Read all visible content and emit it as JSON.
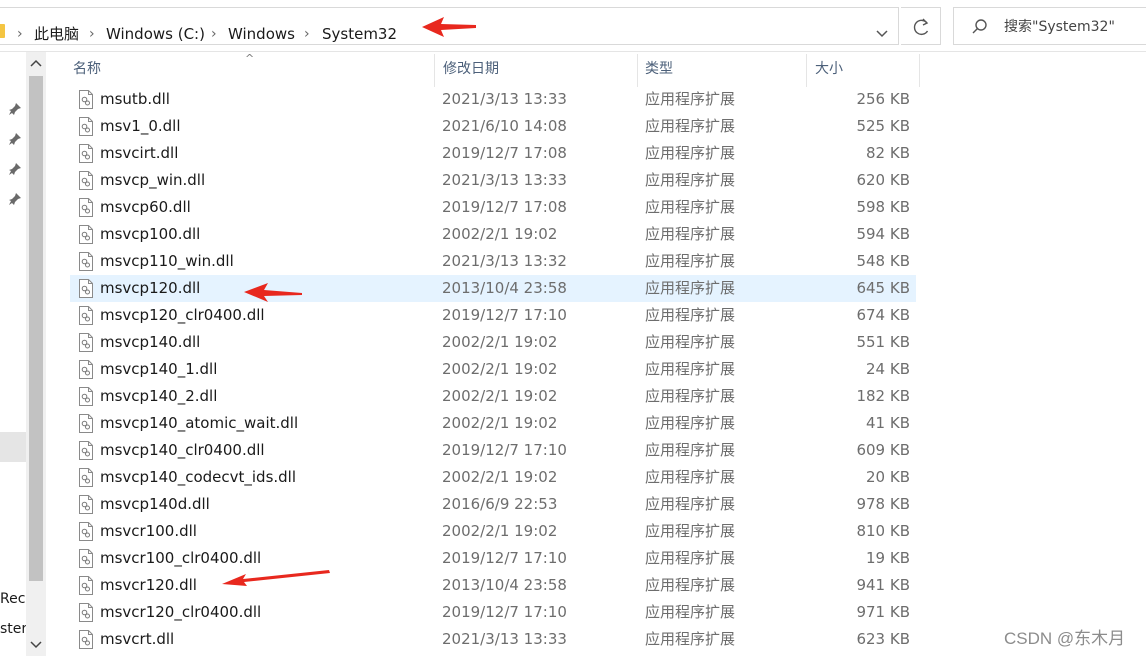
{
  "breadcrumb": {
    "items": [
      "此电脑",
      "Windows (C:)",
      "Windows",
      "System32"
    ]
  },
  "search": {
    "placeholder": "搜索\"System32\""
  },
  "nav": {
    "partial_labels": [
      "Reco",
      "ster"
    ]
  },
  "columns": {
    "name": "名称",
    "date": "修改日期",
    "type": "类型",
    "size": "大小"
  },
  "files": [
    {
      "name": "msutb.dll",
      "date": "2021/3/13 13:33",
      "type": "应用程序扩展",
      "size": "256 KB"
    },
    {
      "name": "msv1_0.dll",
      "date": "2021/6/10 14:08",
      "type": "应用程序扩展",
      "size": "525 KB"
    },
    {
      "name": "msvcirt.dll",
      "date": "2019/12/7 17:08",
      "type": "应用程序扩展",
      "size": "82 KB"
    },
    {
      "name": "msvcp_win.dll",
      "date": "2021/3/13 13:33",
      "type": "应用程序扩展",
      "size": "620 KB"
    },
    {
      "name": "msvcp60.dll",
      "date": "2019/12/7 17:08",
      "type": "应用程序扩展",
      "size": "598 KB"
    },
    {
      "name": "msvcp100.dll",
      "date": "2002/2/1 19:02",
      "type": "应用程序扩展",
      "size": "594 KB"
    },
    {
      "name": "msvcp110_win.dll",
      "date": "2021/3/13 13:32",
      "type": "应用程序扩展",
      "size": "548 KB"
    },
    {
      "name": "msvcp120.dll",
      "date": "2013/10/4 23:58",
      "type": "应用程序扩展",
      "size": "645 KB"
    },
    {
      "name": "msvcp120_clr0400.dll",
      "date": "2019/12/7 17:10",
      "type": "应用程序扩展",
      "size": "674 KB"
    },
    {
      "name": "msvcp140.dll",
      "date": "2002/2/1 19:02",
      "type": "应用程序扩展",
      "size": "551 KB"
    },
    {
      "name": "msvcp140_1.dll",
      "date": "2002/2/1 19:02",
      "type": "应用程序扩展",
      "size": "24 KB"
    },
    {
      "name": "msvcp140_2.dll",
      "date": "2002/2/1 19:02",
      "type": "应用程序扩展",
      "size": "182 KB"
    },
    {
      "name": "msvcp140_atomic_wait.dll",
      "date": "2002/2/1 19:02",
      "type": "应用程序扩展",
      "size": "41 KB"
    },
    {
      "name": "msvcp140_clr0400.dll",
      "date": "2019/12/7 17:10",
      "type": "应用程序扩展",
      "size": "609 KB"
    },
    {
      "name": "msvcp140_codecvt_ids.dll",
      "date": "2002/2/1 19:02",
      "type": "应用程序扩展",
      "size": "20 KB"
    },
    {
      "name": "msvcp140d.dll",
      "date": "2016/6/9 22:53",
      "type": "应用程序扩展",
      "size": "978 KB"
    },
    {
      "name": "msvcr100.dll",
      "date": "2002/2/1 19:02",
      "type": "应用程序扩展",
      "size": "810 KB"
    },
    {
      "name": "msvcr100_clr0400.dll",
      "date": "2019/12/7 17:10",
      "type": "应用程序扩展",
      "size": "19 KB"
    },
    {
      "name": "msvcr120.dll",
      "date": "2013/10/4 23:58",
      "type": "应用程序扩展",
      "size": "941 KB"
    },
    {
      "name": "msvcr120_clr0400.dll",
      "date": "2019/12/7 17:10",
      "type": "应用程序扩展",
      "size": "971 KB"
    },
    {
      "name": "msvcrt.dll",
      "date": "2021/3/13 13:33",
      "type": "应用程序扩展",
      "size": "623 KB"
    }
  ],
  "selected_file": "msvcp120.dll",
  "icons": {
    "dropdown": "chevron-down-icon",
    "refresh": "refresh-icon",
    "search": "search-icon",
    "pin": "pin-icon",
    "file": "dll-file-icon",
    "annotation": "red-arrow-icon"
  },
  "colors": {
    "selection": "#e5f3ff",
    "header_text": "#4c607a",
    "annotation_arrow": "#e8281e"
  },
  "watermark": "CSDN @东木月"
}
